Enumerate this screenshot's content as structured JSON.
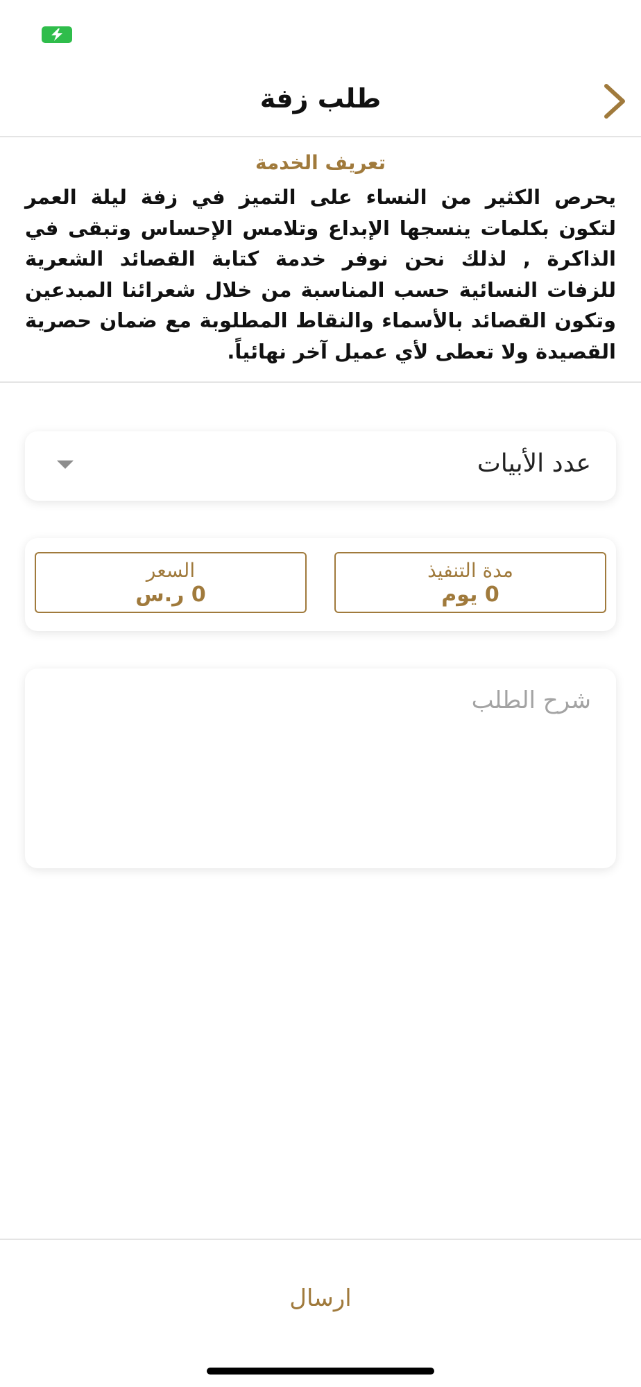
{
  "status_bar": {
    "battery_icon": "battery-charging-icon",
    "battery_color": "#2fbd4b"
  },
  "nav": {
    "title": "طلب زفة",
    "back_icon": "chevron-right-icon"
  },
  "service": {
    "heading": "تعريف الخدمة",
    "description": "يحرص الكثير من النساء على التميز في زفة ليلة العمر لتكون بكلمات ينسجها الإبداع وتلامس الإحساس وتبقى في الذاكرة , لذلك نحن نوفر خدمة كتابة القصائد الشعرية للزفات النسائية حسب المناسبة من خلال شعرائنا المبدعين وتكون القصائد بالأسماء والنقاط المطلوبة مع ضمان حصرية القصيدة ولا تعطى لأي عميل آخر نهائياً."
  },
  "verses_select": {
    "label": "عدد الأبيات",
    "arrow_icon": "caret-down-icon"
  },
  "info": {
    "duration_label": "مدة التنفيذ",
    "duration_value": "0 يوم",
    "price_label": "السعر",
    "price_value": "0 ر.س"
  },
  "request_description": {
    "placeholder": "شرح الطلب",
    "value": ""
  },
  "actions": {
    "send_label": "ارسال"
  },
  "colors": {
    "accent": "#a07a3c",
    "text": "#111111",
    "divider": "#e4e4e4"
  }
}
